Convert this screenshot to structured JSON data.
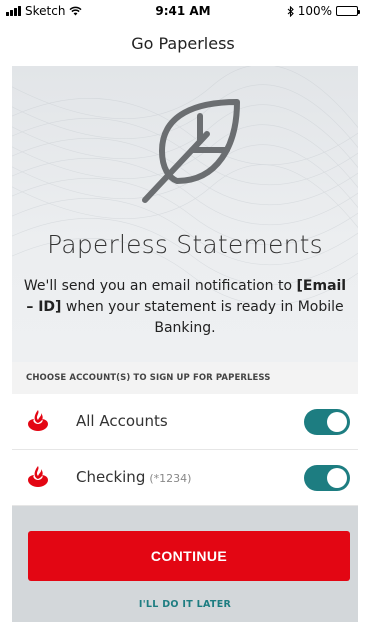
{
  "status_bar": {
    "carrier": "Sketch",
    "time": "9:41 AM",
    "battery": "100%"
  },
  "nav": {
    "title": "Go Paperless"
  },
  "hero": {
    "icon": "leaf-icon",
    "title": "Paperless Statements",
    "message_prefix": "We'll send you an email notification to",
    "message_bold": "[Email – ID]",
    "message_suffix": "when your statement is ready in Mobile Banking."
  },
  "section": {
    "label": "CHOOSE ACCOUNT(S) TO SIGN UP FOR PAPERLESS"
  },
  "accounts": [
    {
      "name": "All Accounts",
      "number": "",
      "enabled": true
    },
    {
      "name": "Checking",
      "number": "(*1234)",
      "enabled": true
    }
  ],
  "actions": {
    "continue_label": "CONTINUE",
    "later_label": "I'LL DO IT LATER"
  },
  "colors": {
    "brand_red": "#e30613",
    "toggle_teal": "#1d7d81",
    "hero_bg": "#e6e8ea",
    "footer_bg": "#d3d7da"
  }
}
